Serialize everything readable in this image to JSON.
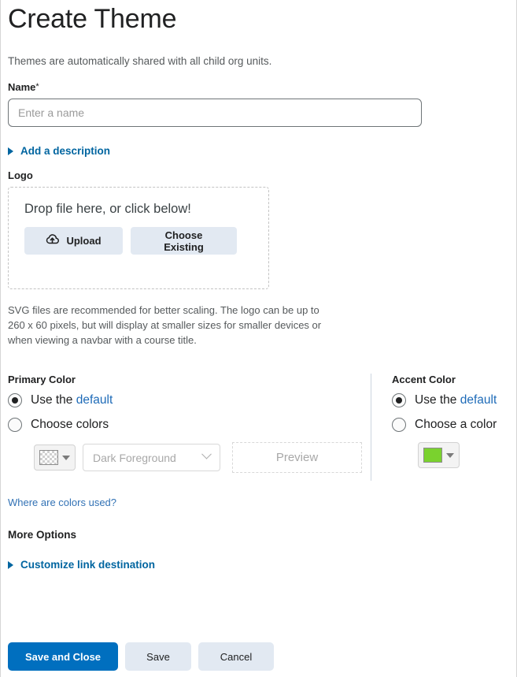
{
  "header": {
    "title": "Create Theme",
    "intro": "Themes are automatically shared with all child org units."
  },
  "name_field": {
    "label": "Name",
    "required_marker": "*",
    "placeholder": "Enter a name",
    "value": ""
  },
  "description_toggle": {
    "label": "Add a description",
    "icon": "triangle-right-icon"
  },
  "logo": {
    "label": "Logo",
    "drop_text": "Drop file here, or click below!",
    "upload_label": "Upload",
    "upload_icon": "cloud-upload-icon",
    "choose_existing_label": "Choose Existing",
    "helper_text": "SVG files are recommended for better scaling. The logo can be up to 260 x 60 pixels, but will display at smaller sizes for smaller devices or when viewing a navbar with a course title."
  },
  "primary_color": {
    "title": "Primary Color",
    "option_default_prefix": "Use the ",
    "option_default_link": "default",
    "option_choose": "Choose colors",
    "selected": "default",
    "swatch_value": "transparent",
    "select_value": "Dark Foreground",
    "preview_label": "Preview"
  },
  "accent_color": {
    "title": "Accent Color",
    "option_default_prefix": "Use the ",
    "option_default_link": "default",
    "option_choose": "Choose a color",
    "selected": "default",
    "swatch_value": "#7AD22E"
  },
  "links": {
    "where_colors_used": "Where are colors used?"
  },
  "more_options": {
    "title": "More Options",
    "customize_link": "Customize link destination",
    "icon": "triangle-right-icon"
  },
  "footer": {
    "save_and_close": "Save and Close",
    "save": "Save",
    "cancel": "Cancel"
  },
  "colors": {
    "primary_button": "#006fbf",
    "link": "#0065a0",
    "accent_swatch": "#7AD22E"
  }
}
